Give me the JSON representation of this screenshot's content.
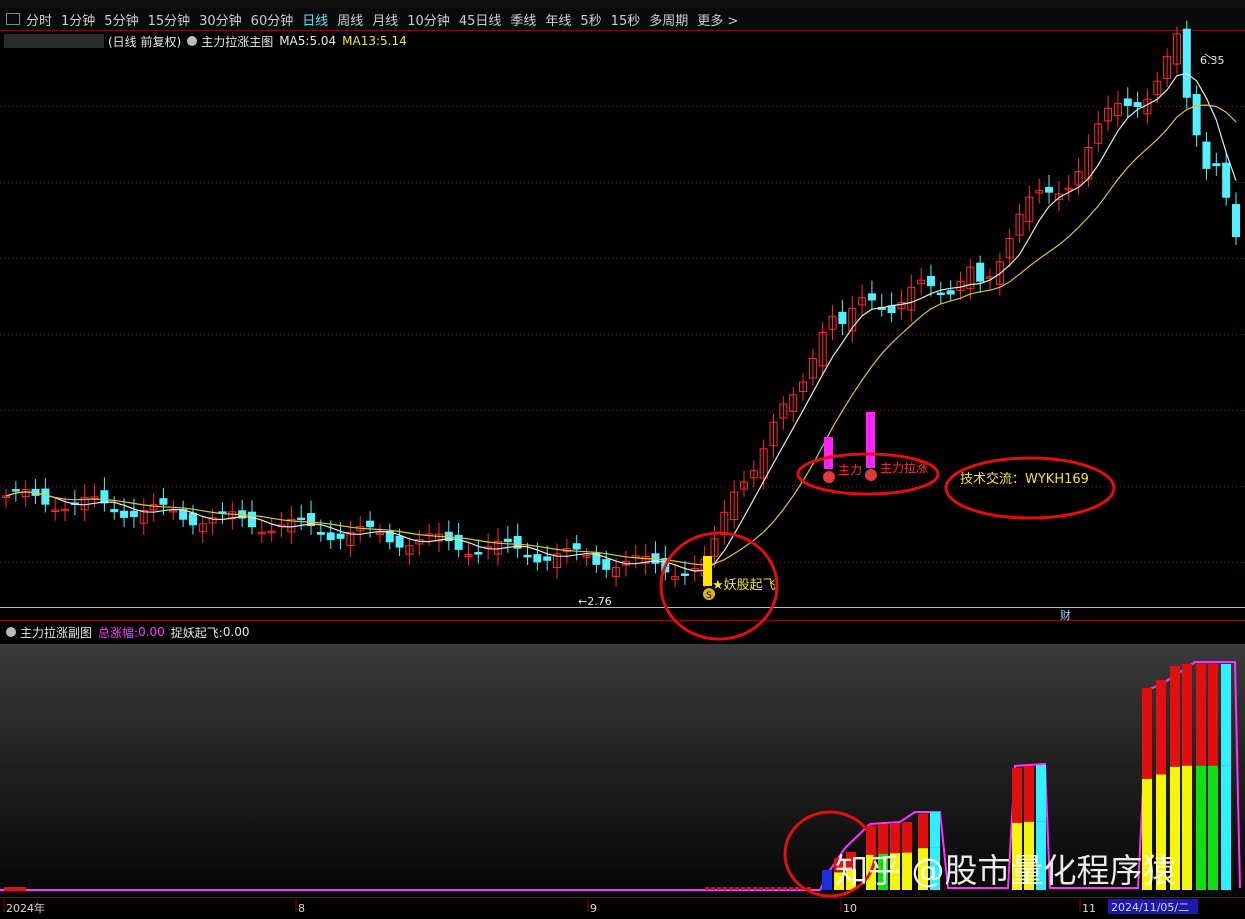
{
  "period_tabs": [
    "分时",
    "1分钟",
    "5分钟",
    "15分钟",
    "30分钟",
    "60分钟",
    "日线",
    "周线",
    "月线",
    "10分钟",
    "45日线",
    "季线",
    "年线",
    "5秒",
    "15秒",
    "多周期",
    "更多 >"
  ],
  "active_tab": "日线",
  "main_legend": {
    "period_label": "(日线 前复权)",
    "indicator_name": "主力拉涨主图",
    "ma5_label": "MA5:",
    "ma5_value": "5.04",
    "ma13_label": "MA13:",
    "ma13_value": "5.14"
  },
  "annotations": {
    "high_price": "6.35",
    "low_price": "2.76",
    "yaogu_label": "★妖股起飞",
    "zhuli_label_a": "主力",
    "zhuli_label_b": "主力拉涨",
    "contact_label": "技术交流：WYKH169",
    "cai_label": "财",
    "s_marker": "S"
  },
  "sub_legend": {
    "indicator_name": "主力拉涨副图",
    "total_label": "总涨幅:",
    "total_value": "0.00",
    "tiyao_label": "捉妖起飞:",
    "tiyao_value": "0.00"
  },
  "watermark": "知乎 @股市量化程序猿",
  "date_axis": {
    "labels": [
      "2024年",
      "8",
      "9",
      "10",
      "11"
    ],
    "cursor_date": "2024/11/05/二"
  },
  "colors": {
    "up": "#ff2b2b",
    "down": "#54f0ff",
    "ma5": "#e6e6e6",
    "ma13": "#d9c43b",
    "highlight_circle": "#e01010",
    "hist_yellow": "#f5f50a",
    "hist_red": "#e01010",
    "hist_green": "#10e010",
    "hist_cyan": "#30f0ff",
    "hist_outline": "#ff33ff"
  }
}
